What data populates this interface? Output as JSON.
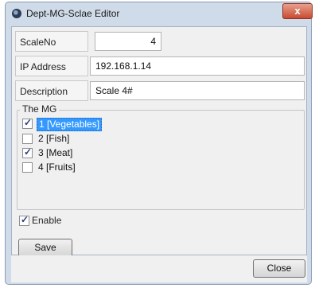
{
  "window": {
    "title": "Dept-MG-Sclae Editor",
    "close_glyph": "x"
  },
  "fields": {
    "scaleno": {
      "label": "ScaleNo",
      "value": "4"
    },
    "ip": {
      "label": "IP Address",
      "value": "192.168.1.14"
    },
    "description": {
      "label": "Description",
      "value": "Scale 4#"
    }
  },
  "group": {
    "title": "The MG",
    "items": [
      {
        "label": "1 [Vegetables]",
        "checked": true,
        "selected": true
      },
      {
        "label": "2 [Fish]",
        "checked": false,
        "selected": false
      },
      {
        "label": "3 [Meat]",
        "checked": true,
        "selected": false
      },
      {
        "label": "4 [Fruits]",
        "checked": false,
        "selected": false
      }
    ]
  },
  "enable": {
    "label": "Enable",
    "checked": true
  },
  "buttons": {
    "save": "Save",
    "close": "Close"
  }
}
